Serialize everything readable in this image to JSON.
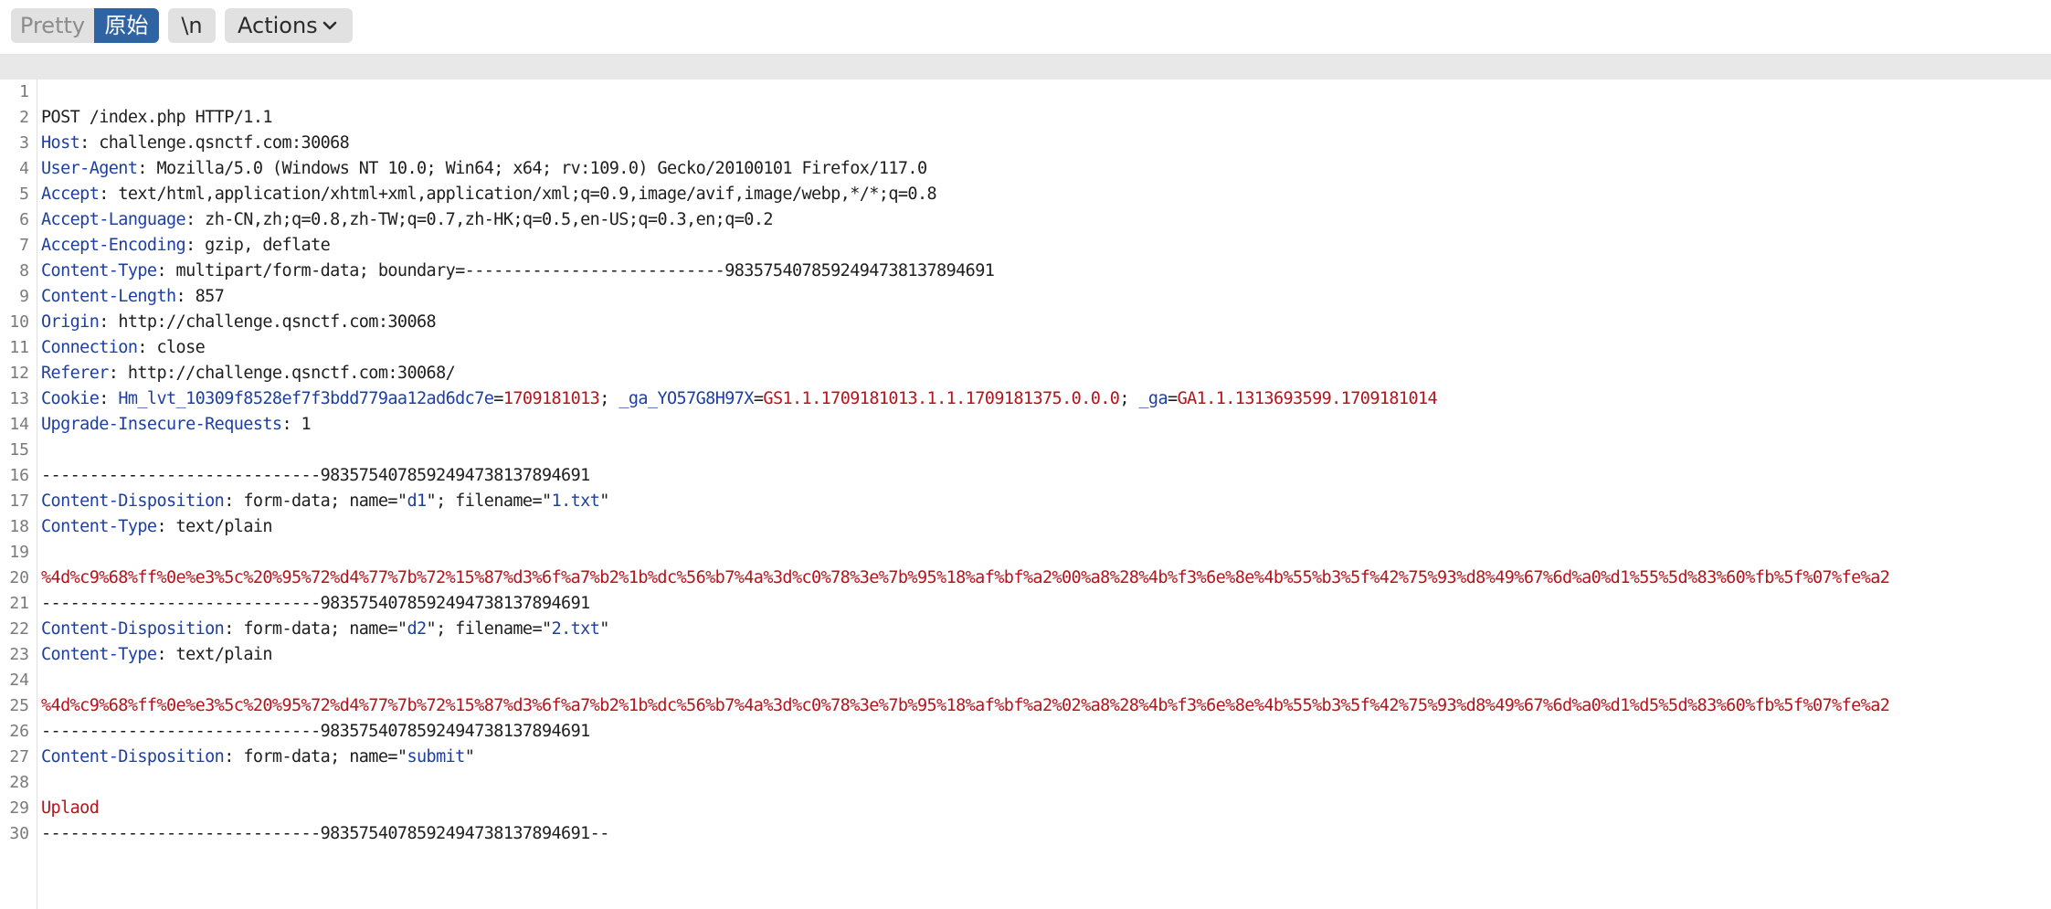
{
  "toolbar": {
    "pretty_label": "Pretty",
    "raw_label": "原始",
    "newline_label": "\\n",
    "actions_label": "Actions"
  },
  "icons": {
    "actions_menu": "chevron-down-icon"
  },
  "colors": {
    "raw_active_bg": "#2f64a4",
    "header_key": "#1f3fa0",
    "value_red": "#b5141c"
  },
  "request": {
    "line1": "POST /index.php HTTP/1.1",
    "headers": {
      "host_key": "Host",
      "host_val": "challenge.qsnctf.com:30068",
      "ua_key": "User-Agent",
      "ua_val": "Mozilla/5.0 (Windows NT 10.0; Win64; x64; rv:109.0) Gecko/20100101 Firefox/117.0",
      "accept_key": "Accept",
      "accept_val": "text/html,application/xhtml+xml,application/xml;q=0.9,image/avif,image/webp,*/*;q=0.8",
      "lang_key": "Accept-Language",
      "lang_val": "zh-CN,zh;q=0.8,zh-TW;q=0.7,zh-HK;q=0.5,en-US;q=0.3,en;q=0.2",
      "enc_key": "Accept-Encoding",
      "enc_val": "gzip, deflate",
      "ctype_key": "Content-Type",
      "ctype_val": "multipart/form-data; boundary=---------------------------9835754078592494738137894691",
      "clen_key": "Content-Length",
      "clen_val": "857",
      "origin_key": "Origin",
      "origin_val": "http://challenge.qsnctf.com:30068",
      "conn_key": "Connection",
      "conn_val": "close",
      "referer_key": "Referer",
      "referer_val": "http://challenge.qsnctf.com:30068/",
      "cookie_key": "Cookie",
      "cookie_n1": "Hm_lvt_10309f8528ef7f3bdd779aa12ad6dc7e",
      "cookie_v1": "1709181013",
      "cookie_n2": "_ga_YO57G8H97X",
      "cookie_v2": "GS1.1.1709181013.1.1.1709181375.0.0.0",
      "cookie_n3": "_ga",
      "cookie_v3": "GA1.1.1313693599.1709181014",
      "upgrade_key": "Upgrade-Insecure-Requests",
      "upgrade_val": "1"
    },
    "body": {
      "boundary": "-----------------------------9835754078592494738137894691",
      "boundary_end": "-----------------------------9835754078592494738137894691--",
      "cd_key": "Content-Disposition",
      "cd_prefix": "form-data; name=",
      "filename_label": "; filename=",
      "ct_key": "Content-Type",
      "ct_val": "text/plain",
      "part1_name": "d1",
      "part1_file": "1.txt",
      "part1_data": "%4d%c9%68%ff%0e%e3%5c%20%95%72%d4%77%7b%72%15%87%d3%6f%a7%b2%1b%dc%56%b7%4a%3d%c0%78%3e%7b%95%18%af%bf%a2%00%a8%28%4b%f3%6e%8e%4b%55%b3%5f%42%75%93%d8%49%67%6d%a0%d1%55%5d%83%60%fb%5f%07%fe%a2",
      "part2_name": "d2",
      "part2_file": "2.txt",
      "part2_data": "%4d%c9%68%ff%0e%e3%5c%20%95%72%d4%77%7b%72%15%87%d3%6f%a7%b2%1b%dc%56%b7%4a%3d%c0%78%3e%7b%95%18%af%bf%a2%02%a8%28%4b%f3%6e%8e%4b%55%b3%5f%42%75%93%d8%49%67%6d%a0%d1%d5%5d%83%60%fb%5f%07%fe%a2",
      "part3_name": "submit",
      "part3_data": "Uplaod"
    }
  }
}
